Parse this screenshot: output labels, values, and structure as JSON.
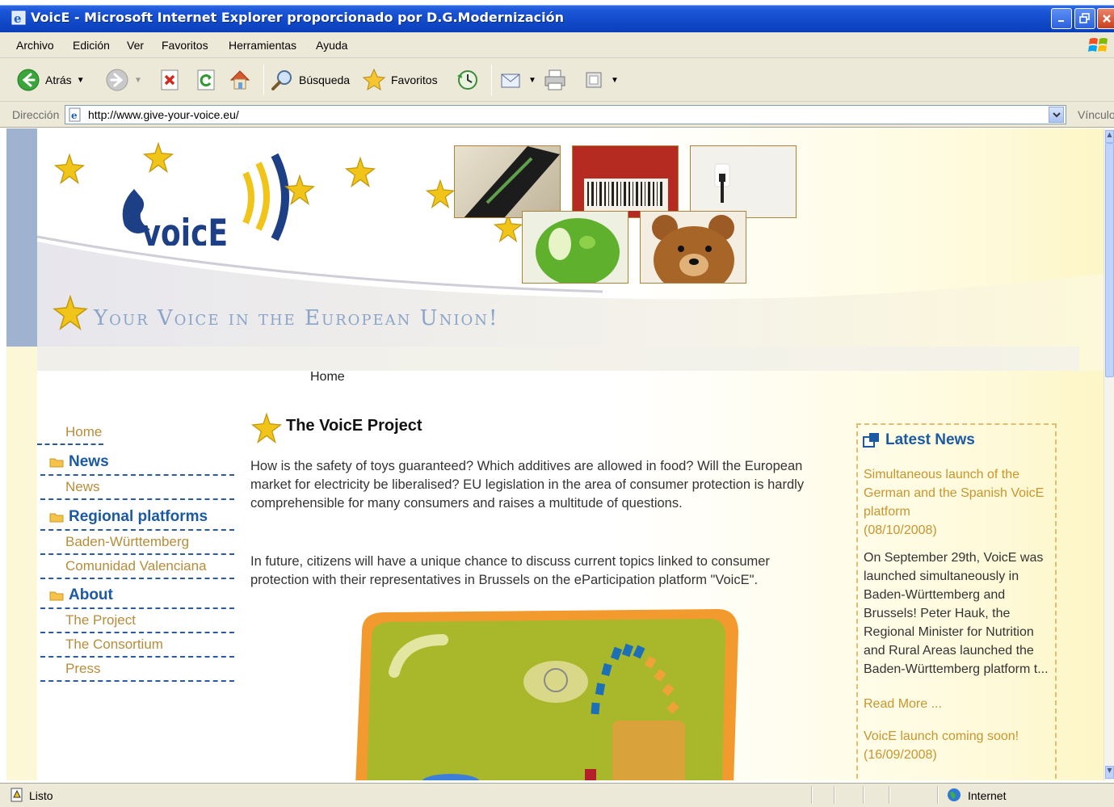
{
  "window": {
    "title": "VoicE - Microsoft Internet Explorer proporcionado por D.G.Modernización"
  },
  "menubar": {
    "items": [
      "Archivo",
      "Edición",
      "Ver",
      "Favoritos",
      "Herramientas",
      "Ayuda"
    ]
  },
  "toolbar": {
    "back_label": "Atrás",
    "search_label": "Búsqueda",
    "favorites_label": "Favoritos"
  },
  "addressbar": {
    "label": "Dirección",
    "url": "http://www.give-your-voice.eu/",
    "links_label": "Vínculo"
  },
  "site": {
    "logo_text": "VoicE",
    "tagline": "Your Voice in the European Union!",
    "breadcrumb": "Home"
  },
  "leftnav": {
    "home": "Home",
    "sections": [
      {
        "heading": "News",
        "links": [
          "News"
        ]
      },
      {
        "heading": "Regional platforms",
        "links": [
          "Baden-Württemberg",
          "Comunidad Valenciana"
        ]
      },
      {
        "heading": "About",
        "links": [
          "The Project",
          "The Consortium",
          "Press"
        ]
      }
    ]
  },
  "main": {
    "title": "The VoicE Project",
    "paragraph1": "How is the safety of toys guaranteed? Which additives are allowed in food? Will the European market for electricity be liberalised? EU legislation in the area of consumer protection is hardly comprehensible for many consumers and raises a multitude of questions.",
    "paragraph2": "In future, citizens will have a unique chance to discuss current topics linked to consumer protection with their representatives in Brussels on the eParticipation platform \"VoicE\"."
  },
  "news": {
    "heading": "Latest News",
    "items": [
      {
        "title": "Simultaneous launch of the German and the Spanish VoicE platform",
        "date": "(08/10/2008)",
        "body": "On September 29th, VoicE was launched simultaneously in Baden-Württemberg and Brussels! Peter Hauk, the Regional Minister for Nutrition and Rural Areas launched the Baden-Württemberg platform t...",
        "read_more": "Read More ..."
      },
      {
        "title": "VoicE launch coming soon!",
        "date": "(16/09/2008)"
      }
    ]
  },
  "statusbar": {
    "status": "Listo",
    "zone": "Internet"
  },
  "colors": {
    "nav_heading": "#1b5aa3",
    "nav_link": "#b78d3a",
    "news_link": "#c9952d",
    "titlebar": "#0f46c4"
  }
}
